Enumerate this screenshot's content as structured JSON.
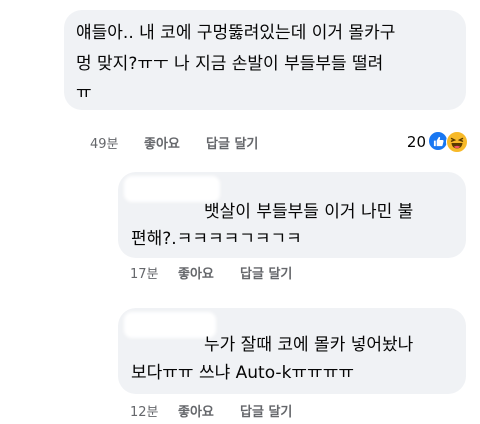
{
  "comments": [
    {
      "lines": [
        "얘들아.. 내 코에 구멍뚫려있는데 이거 몰카구",
        "멍 맞지?ㅠㅜ 나 지금 손발이 부들부들 떨려",
        "ㅠ"
      ],
      "time": "49분",
      "like_label": "좋아요",
      "reply_label": "답글 달기",
      "reaction_count": "20",
      "reaction_icons": [
        "like-icon",
        "haha-icon"
      ]
    },
    {
      "lines": [
        "뱃살이 부들부들 이거 나민 불",
        "편해?.ㅋㅋㅋㅋㄱㅋㄱㅋ"
      ],
      "time": "17분",
      "like_label": "좋아요",
      "reply_label": "답글 달기"
    },
    {
      "lines": [
        "누가 잘때 코에 몰카 넣어놨나",
        "보다ㅠㅠ 쓰냐 Auto-kㅠㅠㅠㅠ"
      ],
      "time": "12분",
      "like_label": "좋아요",
      "reply_label": "답글 달기"
    }
  ],
  "colors": {
    "bubble_bg": "#f0f2f5",
    "meta_text": "#65676b",
    "like_blue": "#1877f2",
    "haha_yellow": "#f7b928"
  }
}
